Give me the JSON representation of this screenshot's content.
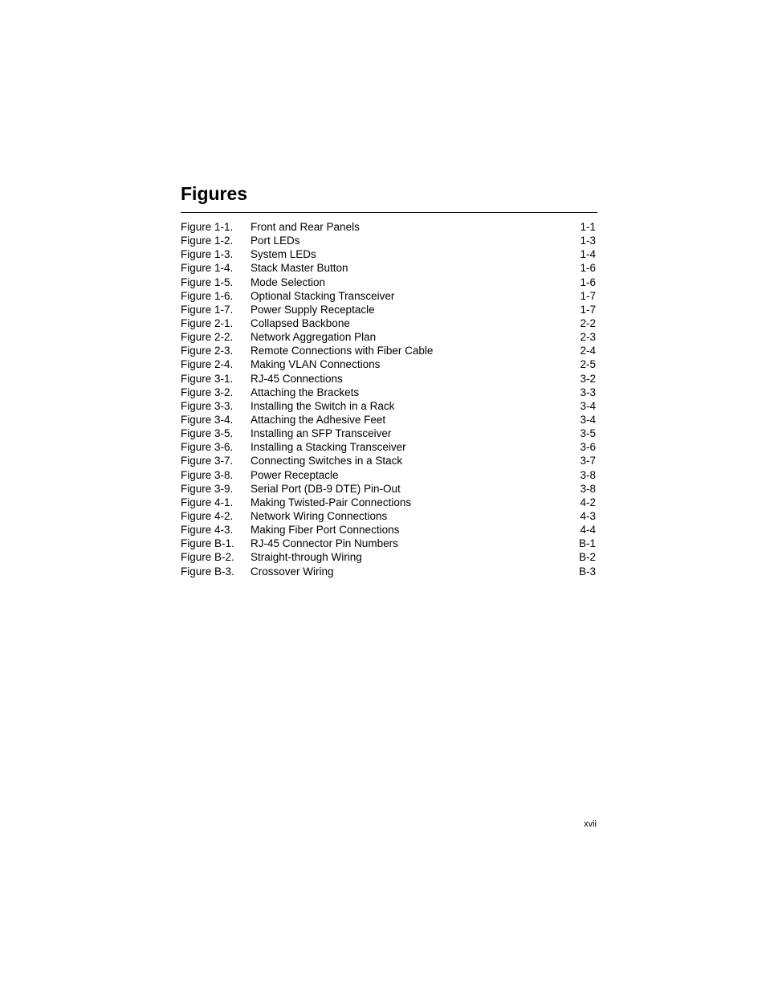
{
  "page": {
    "title": "Figures",
    "folio": "xvii"
  },
  "figures": [
    {
      "number": "Figure 1-1.",
      "caption": "Front and Rear Panels",
      "page": "1-1"
    },
    {
      "number": "Figure 1-2.",
      "caption": "Port LEDs",
      "page": "1-3"
    },
    {
      "number": "Figure 1-3.",
      "caption": "System LEDs",
      "page": "1-4"
    },
    {
      "number": "Figure 1-4.",
      "caption": "Stack Master Button",
      "page": "1-6"
    },
    {
      "number": "Figure 1-5.",
      "caption": "Mode Selection",
      "page": "1-6"
    },
    {
      "number": "Figure 1-6.",
      "caption": "Optional Stacking Transceiver",
      "page": "1-7"
    },
    {
      "number": "Figure 1-7.",
      "caption": "Power Supply Receptacle",
      "page": "1-7"
    },
    {
      "number": "Figure 2-1.",
      "caption": "Collapsed Backbone",
      "page": "2-2"
    },
    {
      "number": "Figure 2-2.",
      "caption": "Network Aggregation Plan",
      "page": "2-3"
    },
    {
      "number": "Figure 2-3.",
      "caption": "Remote Connections with Fiber Cable",
      "page": "2-4"
    },
    {
      "number": "Figure 2-4.",
      "caption": "Making VLAN Connections",
      "page": "2-5"
    },
    {
      "number": "Figure 3-1.",
      "caption": "RJ-45 Connections",
      "page": "3-2"
    },
    {
      "number": "Figure 3-2.",
      "caption": "Attaching the Brackets",
      "page": "3-3"
    },
    {
      "number": "Figure 3-3.",
      "caption": "Installing the Switch in a Rack",
      "page": "3-4"
    },
    {
      "number": "Figure 3-4.",
      "caption": "Attaching the Adhesive Feet",
      "page": "3-4"
    },
    {
      "number": "Figure 3-5.",
      "caption": "Installing an SFP Transceiver",
      "page": "3-5"
    },
    {
      "number": "Figure 3-6.",
      "caption": "Installing a Stacking Transceiver",
      "page": "3-6"
    },
    {
      "number": "Figure 3-7.",
      "caption": "Connecting Switches in a Stack",
      "page": "3-7"
    },
    {
      "number": "Figure 3-8.",
      "caption": "Power Receptacle",
      "page": "3-8"
    },
    {
      "number": "Figure 3-9.",
      "caption": "Serial Port (DB-9 DTE) Pin-Out",
      "page": "3-8"
    },
    {
      "number": "Figure 4-1.",
      "caption": "Making Twisted-Pair Connections",
      "page": "4-2"
    },
    {
      "number": "Figure 4-2.",
      "caption": "Network Wiring Connections",
      "page": "4-3"
    },
    {
      "number": "Figure 4-3.",
      "caption": "Making Fiber Port Connections",
      "page": "4-4"
    },
    {
      "number": "Figure B-1.",
      "caption": "RJ-45 Connector Pin Numbers",
      "page": "B-1"
    },
    {
      "number": "Figure B-2.",
      "caption": "Straight-through Wiring",
      "page": "B-2"
    },
    {
      "number": "Figure B-3.",
      "caption": "Crossover Wiring",
      "page": "B-3"
    }
  ]
}
